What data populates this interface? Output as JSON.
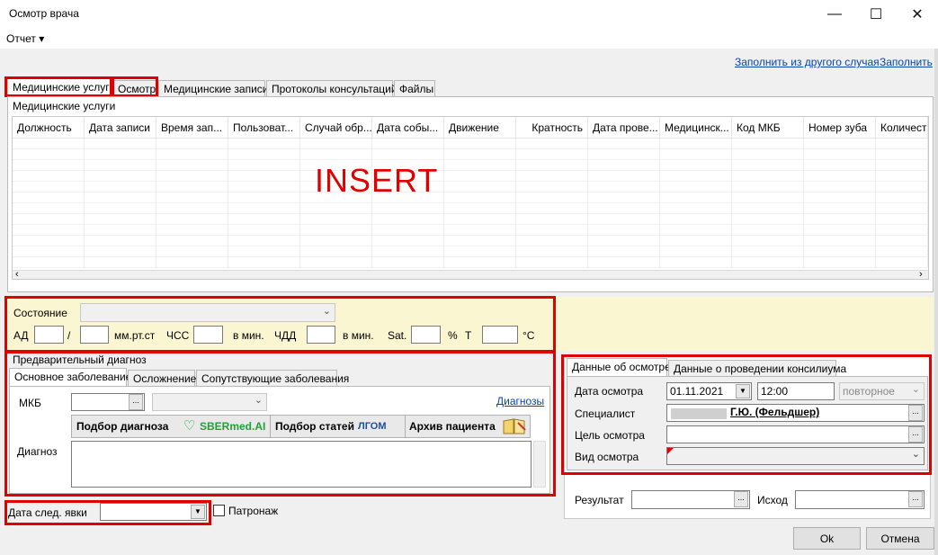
{
  "window": {
    "title": "Осмотр врача",
    "minimize": "—",
    "maximize": "☐",
    "close": "✕"
  },
  "menu": {
    "report": "Отчет ▾"
  },
  "top_links": {
    "fill_from_other": "Заполнить из другого случая",
    "fill": "Заполнить"
  },
  "tabs": [
    {
      "label": "Медицинские услуги"
    },
    {
      "label": "Осмотр"
    },
    {
      "label": "Медицинские записи"
    },
    {
      "label": "Протоколы консультаций"
    },
    {
      "label": "Файлы"
    }
  ],
  "services": {
    "group_title": "Медицинские услуги",
    "columns": [
      "Должность",
      "Дата записи",
      "Время зап...",
      "Пользоват...",
      "Случай обр...",
      "Дата собы...",
      "Движение",
      "Кратность",
      "Дата прове...",
      "Медицинск...",
      "Код МКБ",
      "Номер зуба",
      "Количеств"
    ],
    "overlay_text": "INSERT"
  },
  "vitals": {
    "state_label": "Состояние",
    "ad_label": "АД",
    "slash": "/",
    "mmhg": "мм.рт.ст",
    "hr_label": "ЧСС",
    "per_min1": "в мин.",
    "rr_label": "ЧДД",
    "per_min2": "в мин.",
    "sat_label": "Sat.",
    "percent": "%",
    "t_label": "Т",
    "celsius": "°С"
  },
  "diagnosis": {
    "group_title": "Предварительный диагноз",
    "tabs": [
      "Основное заболевание",
      "Осложнение",
      "Сопутствующие заболевания"
    ],
    "mkb_label": "МКБ",
    "diagnoses_link": "Диагнозы",
    "buttons": [
      "Подбор диагноза",
      "Подбор статей",
      "Архив пациента"
    ],
    "sber_logo": "SBERmed.AI",
    "lgom_logo": "ЛГОМ",
    "diagnosis_label": "Диагноз"
  },
  "next_visit": {
    "label": "Дата след. явки",
    "patronage": "Патронаж"
  },
  "exam": {
    "tabs": [
      "Данные об осмотре",
      "Данные о проведении консилиума"
    ],
    "date_label": "Дата осмотра",
    "date_value": "01.11.2021",
    "time_value": "12:00",
    "visit_type": "повторное",
    "specialist_label": "Специалист",
    "specialist_value": "Г.Ю. (Фельдшер)",
    "purpose_label": "Цель осмотра",
    "kind_label": "Вид осмотра"
  },
  "result": {
    "result_label": "Результат",
    "outcome_label": "Исход"
  },
  "footer": {
    "ok": "Ok",
    "cancel": "Отмена"
  },
  "colors": {
    "highlight": "#e00000",
    "vitals_bg": "#fbf6d2",
    "link": "#0645ad",
    "insert_text": "#e00000"
  }
}
